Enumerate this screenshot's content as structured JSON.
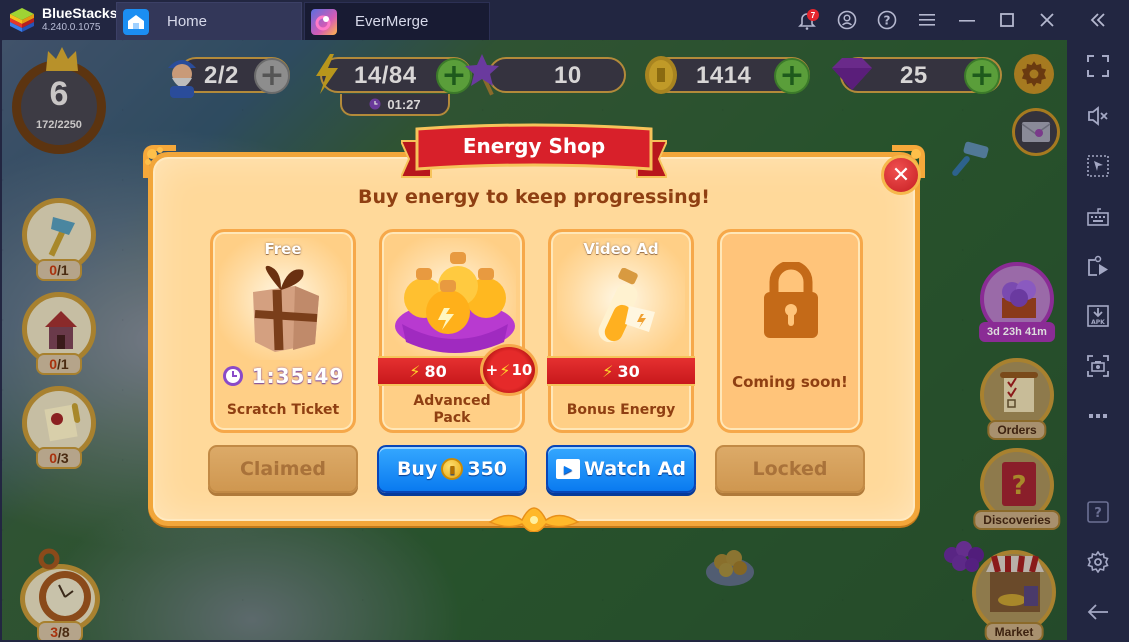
{
  "titlebar": {
    "app_name": "BlueStacks",
    "app_version": "4.240.0.1075",
    "tabs": [
      {
        "label": "Home",
        "icon": "home-icon",
        "active": false
      },
      {
        "label": "EverMerge",
        "icon": "evermerge-app-icon",
        "active": true
      }
    ],
    "notification_count": "7",
    "controls": [
      "bell-icon",
      "account-icon",
      "help-icon",
      "menu-icon",
      "minimize-icon",
      "maximize-icon",
      "close-icon",
      "collapse-sidebar-icon"
    ]
  },
  "sidebar": {
    "tools": [
      {
        "name": "fullscreen",
        "icon": "fullscreen-icon"
      },
      {
        "name": "volume-muted",
        "icon": "mute-icon"
      },
      {
        "name": "pointer-mode",
        "icon": "cursor-select-icon"
      },
      {
        "name": "keyboard-controls",
        "icon": "keyboard-icon"
      },
      {
        "name": "media-manager",
        "icon": "media-play-icon"
      },
      {
        "name": "install-apk",
        "icon": "apk-icon"
      },
      {
        "name": "screenshot",
        "icon": "camera-icon"
      },
      {
        "name": "more",
        "icon": "more-icon"
      },
      {
        "name": "help",
        "icon": "help-square-icon"
      },
      {
        "name": "settings",
        "icon": "gear-icon"
      },
      {
        "name": "back",
        "icon": "back-arrow-icon"
      }
    ]
  },
  "game": {
    "level": {
      "value": "6",
      "xp": "172/2250"
    },
    "resources": {
      "workers": "2/2",
      "energy": "14/84",
      "energy_timer": "01:27",
      "stars": "10",
      "coins": "1414",
      "gems": "25"
    },
    "left_quests": [
      {
        "icon": "axe-icon",
        "progress_done": "0",
        "progress_total": "/1"
      },
      {
        "icon": "house-icon",
        "progress_done": "0",
        "progress_total": "/1"
      },
      {
        "icon": "scroll-icon",
        "progress_done": "0",
        "progress_total": "/3"
      },
      {
        "icon": "pocket-watch-icon",
        "progress_done": "3",
        "progress_total": "/8"
      }
    ],
    "right_buttons": {
      "event_timer": "3d 23h 41m",
      "orders": "Orders",
      "discoveries": "Discoveries",
      "market": "Market"
    }
  },
  "modal": {
    "title": "Energy Shop",
    "subtitle": "Buy energy to keep progressing!",
    "cards": [
      {
        "top_label": "Free",
        "name": "Scratch Ticket",
        "timer": "1:35:49",
        "button": "Claimed",
        "button_state": "disabled"
      },
      {
        "name": "Advanced Pack",
        "energy": "80",
        "bonus": "10",
        "button_prefix": "Buy",
        "button_price": "350",
        "button_state": "active"
      },
      {
        "top_label": "Video Ad",
        "name": "Bonus Energy",
        "energy": "30",
        "button": "Watch Ad",
        "button_state": "active"
      },
      {
        "name": "Coming soon!",
        "button": "Locked",
        "button_state": "disabled"
      }
    ]
  },
  "colors": {
    "modal_bg": "#ffd99a",
    "modal_border": "#f2a63a",
    "ribbon_red": "#d8202a",
    "text_brown": "#8f3f12",
    "button_blue": "#0a7af0",
    "button_disabled": "#d6a05c",
    "bluestacks_bg": "#222641"
  }
}
